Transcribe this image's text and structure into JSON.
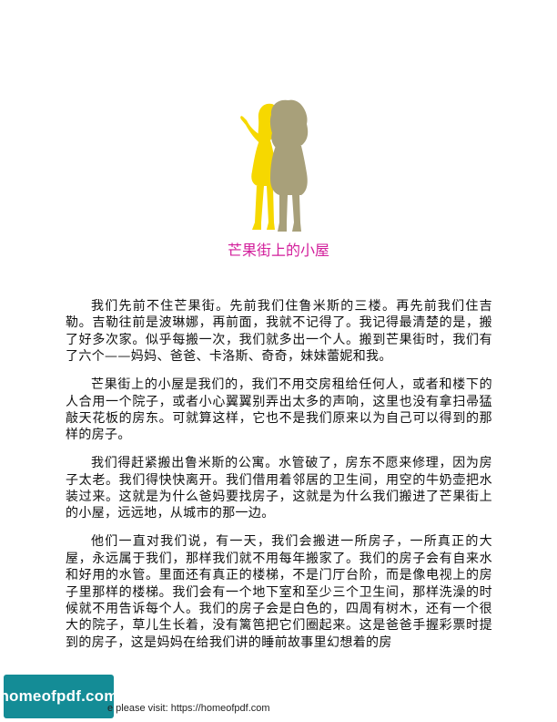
{
  "chapter": {
    "title": "芒果街上的小屋",
    "title_color": "#d21e9b",
    "illustration": "two-girls-silhouette",
    "illustration_colors": [
      "#f6d800",
      "#a8a07a"
    ]
  },
  "paragraphs": [
    "我们先前不住芒果街。先前我们住鲁米斯的三楼。再先前我们住吉勒。吉勒往前是波琳娜，再前面，我就不记得了。我记得最清楚的是，搬了好多次家。似乎每搬一次，我们就多出一个人。搬到芒果街时，我们有了六个——妈妈、爸爸、卡洛斯、奇奇，妹妹蕾妮和我。",
    "芒果街上的小屋是我们的，我们不用交房租给任何人，或者和楼下的人合用一个院子，或者小心翼翼别弄出太多的声响，这里也没有拿扫帚猛敲天花板的房东。可就算这样，它也不是我们原来以为自己可以得到的那样的房子。",
    "我们得赶紧搬出鲁米斯的公寓。水管破了，房东不愿来修理，因为房子太老。我们得快快离开。我们借用着邻居的卫生间，用空的牛奶壶把水装过来。这就是为什么爸妈要找房子，这就是为什么我们搬进了芒果街上的小屋，远远地，从城市的那一边。",
    "他们一直对我们说，有一天，我们会搬进一所房子，一所真正的大屋，永远属于我们，那样我们就不用每年搬家了。我们的房子会有自来水和好用的水管。里面还有真正的楼梯，不是门厅台阶，而是像电视上的房子里那样的楼梯。我们会有一个地下室和至少三个卫生间，那样洗澡的时候就不用告诉每个人。我们的房子会是白色的，四周有树木，还有一个很大的院子，草儿生长着，没有篱笆把它们圈起来。这是爸爸手握彩票时提到的房子，这是妈妈在给我们讲的睡前故事里幻想着的房"
  ],
  "footer": {
    "badge": "homeofpdf.com",
    "badge_color": "#148c96",
    "notice": "e please visit: https://homeofpdf.com"
  }
}
